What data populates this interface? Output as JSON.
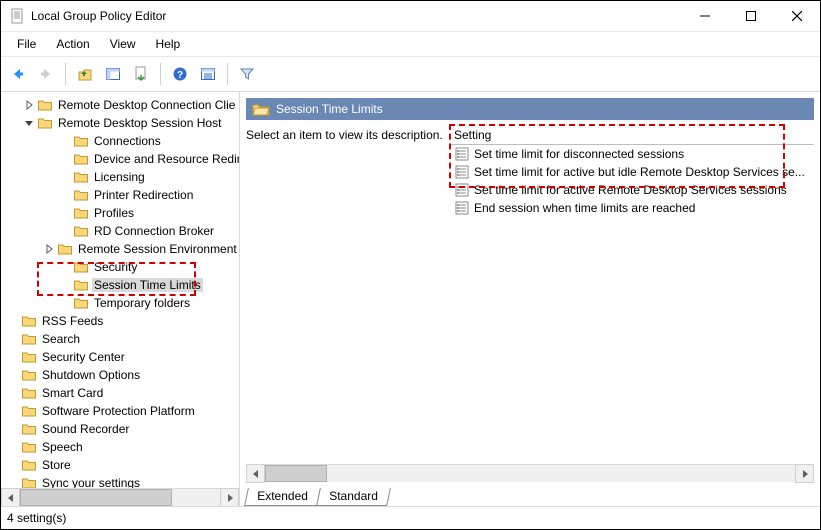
{
  "title": "Local Group Policy Editor",
  "menu": [
    "File",
    "Action",
    "View",
    "Help"
  ],
  "description_prompt": "Select an item to view its description.",
  "settings_header": "Setting",
  "tree": {
    "top": [
      {
        "label": "Remote Desktop Connection Clie",
        "twisty": "closed",
        "indent": 20
      },
      {
        "label": "Remote Desktop Session Host",
        "twisty": "open",
        "indent": 20
      },
      {
        "label": "Connections",
        "twisty": "none",
        "indent": 56
      },
      {
        "label": "Device and Resource Redirecti",
        "twisty": "none",
        "indent": 56
      },
      {
        "label": "Licensing",
        "twisty": "none",
        "indent": 56
      },
      {
        "label": "Printer Redirection",
        "twisty": "none",
        "indent": 56
      },
      {
        "label": "Profiles",
        "twisty": "none",
        "indent": 56
      },
      {
        "label": "RD Connection Broker",
        "twisty": "none",
        "indent": 56
      },
      {
        "label": "Remote Session Environment",
        "twisty": "closed",
        "indent": 40
      },
      {
        "label": "Security",
        "twisty": "none",
        "indent": 56
      },
      {
        "label": "Session Time Limits",
        "twisty": "none",
        "indent": 56,
        "selected": true
      },
      {
        "label": "Temporary folders",
        "twisty": "none",
        "indent": 56
      }
    ],
    "bottom": [
      "RSS Feeds",
      "Search",
      "Security Center",
      "Shutdown Options",
      "Smart Card",
      "Software Protection Platform",
      "Sound Recorder",
      "Speech",
      "Store",
      "Sync your settings"
    ]
  },
  "header_band": "Session Time Limits",
  "settings": [
    "Set time limit for disconnected sessions",
    "Set time limit for active but idle Remote Desktop Services se...",
    "Set time limit for active Remote Desktop Services sessions",
    "End session when time limits are reached"
  ],
  "tabs": [
    "Extended",
    "Standard"
  ],
  "status": "4 setting(s)"
}
